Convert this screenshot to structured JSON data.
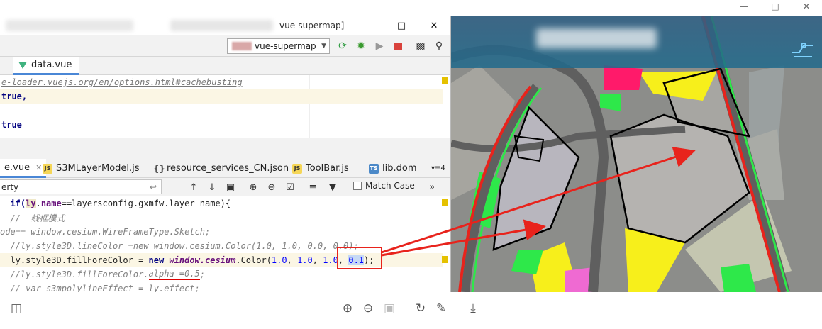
{
  "ide": {
    "title_suffix": "-vue-supermap]",
    "run_config": "vue-supermap",
    "top_tab": "data.vue",
    "top_code": [
      {
        "text": "e-loader.vuejs.org/en/options.html#cachebusting",
        "kind": "link"
      },
      {
        "text": "true,",
        "kind": "kw"
      },
      {
        "text": "",
        "kind": "plain"
      },
      {
        "text": "true",
        "kind": "kw"
      }
    ],
    "bottom_tabs": [
      {
        "label": "e.vue",
        "icon": "vue"
      },
      {
        "label": "S3MLayerModel.js",
        "icon": "JS"
      },
      {
        "label": "resource_services_CN.json",
        "icon": "json"
      },
      {
        "label": "ToolBar.js",
        "icon": "JS"
      },
      {
        "label": "lib.dom",
        "icon": "TS"
      }
    ],
    "tabs_overflow": "4",
    "search_value": "erty",
    "match_case_label": "Match Case",
    "code": {
      "l1_a": "  if(",
      "l1_b": "ly",
      "l1_c": ".",
      "l1_d": "name",
      "l1_e": "==layersconfig.gxmfw.layer_name){",
      "l2": "  //  线框模式",
      "l3": "ode== window.cesium.WireFrameType.Sketch;",
      "l4": "  //ly.style3D.lineColor =new window.cesium.Color(1.0, 1.0, 0.0, 0.0);",
      "l5_a": "  ly.style3D.fillForeColor = ",
      "l5_new": "new ",
      "l5_b": "window.cesium",
      "l5_c": ".Color(",
      "l5_n1": "1.0",
      "l5_sep1": ", ",
      "l5_n2": "1.0",
      "l5_sep2": ", ",
      "l5_n3": "1.0",
      "l5_sep3": ", ",
      "l5_n4": "0.1",
      "l5_end": ");",
      "l6_a": "  //ly.style3D.fillForeColor.",
      "l6_b": "alpha =0.5",
      "l6_c": ";",
      "l7": "  // var s3mpolylineEffect = ly.effect;"
    }
  },
  "colors": {
    "annotation_red": "#e8231c",
    "tab_underline": "#4a87d6",
    "map_green": "#2ee84a",
    "map_yellow": "#f7ef1b",
    "map_magenta": "#ff1a6a"
  },
  "icons": [
    "minimize-icon",
    "maximize-icon",
    "close-icon",
    "refresh-icon",
    "debug-icon",
    "stop-icon",
    "search-icon",
    "zoom-in-icon",
    "zoom-out-icon",
    "rotate-icon",
    "edit-icon",
    "download-icon"
  ]
}
